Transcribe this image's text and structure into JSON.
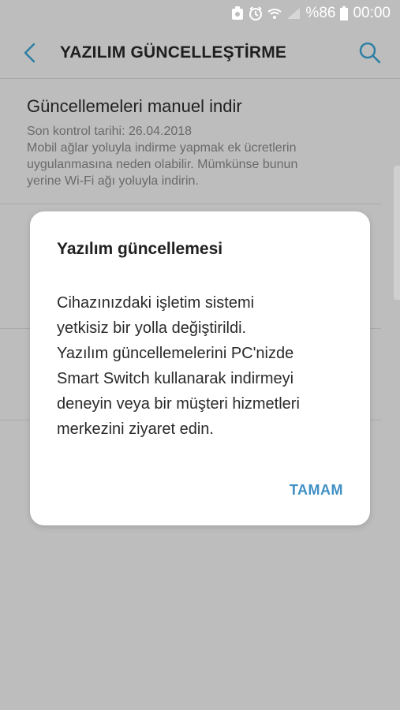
{
  "status_bar": {
    "battery": "%86",
    "time": "00:00",
    "icons": [
      "notification-icon",
      "alarm-icon",
      "wifi-icon",
      "signal-icon",
      "battery-icon"
    ]
  },
  "app_bar": {
    "title": "YAZILIM GÜNCELLEŞTİRME",
    "back_icon": "back-arrow-icon",
    "search_icon": "search-icon"
  },
  "list": {
    "items": [
      {
        "title": "Güncellemeleri manuel indir",
        "lines": [
          "Son kontrol tarihi: 26.04.2018",
          "Mobil ağlar yoluyla indirme yapmak ek ücretlerin",
          "uygulanmasına neden olabilir. Mümkünse bunun",
          "yerine Wi-Fi ağı yoluyla indirin."
        ]
      }
    ]
  },
  "dialog": {
    "title": "Yazılım güncellemesi",
    "message_lines": [
      "Cihazınızdaki işletim sistemi",
      "yetkisiz bir yolla değiştirildi.",
      "Yazılım güncellemelerini PC'nizde",
      "Smart Switch kullanarak indirmeyi",
      "deneyin veya bir müşteri hizmetleri",
      "merkezini ziyaret edin."
    ],
    "ok_label": "TAMAM",
    "accent_color": "#3f8fc4"
  }
}
